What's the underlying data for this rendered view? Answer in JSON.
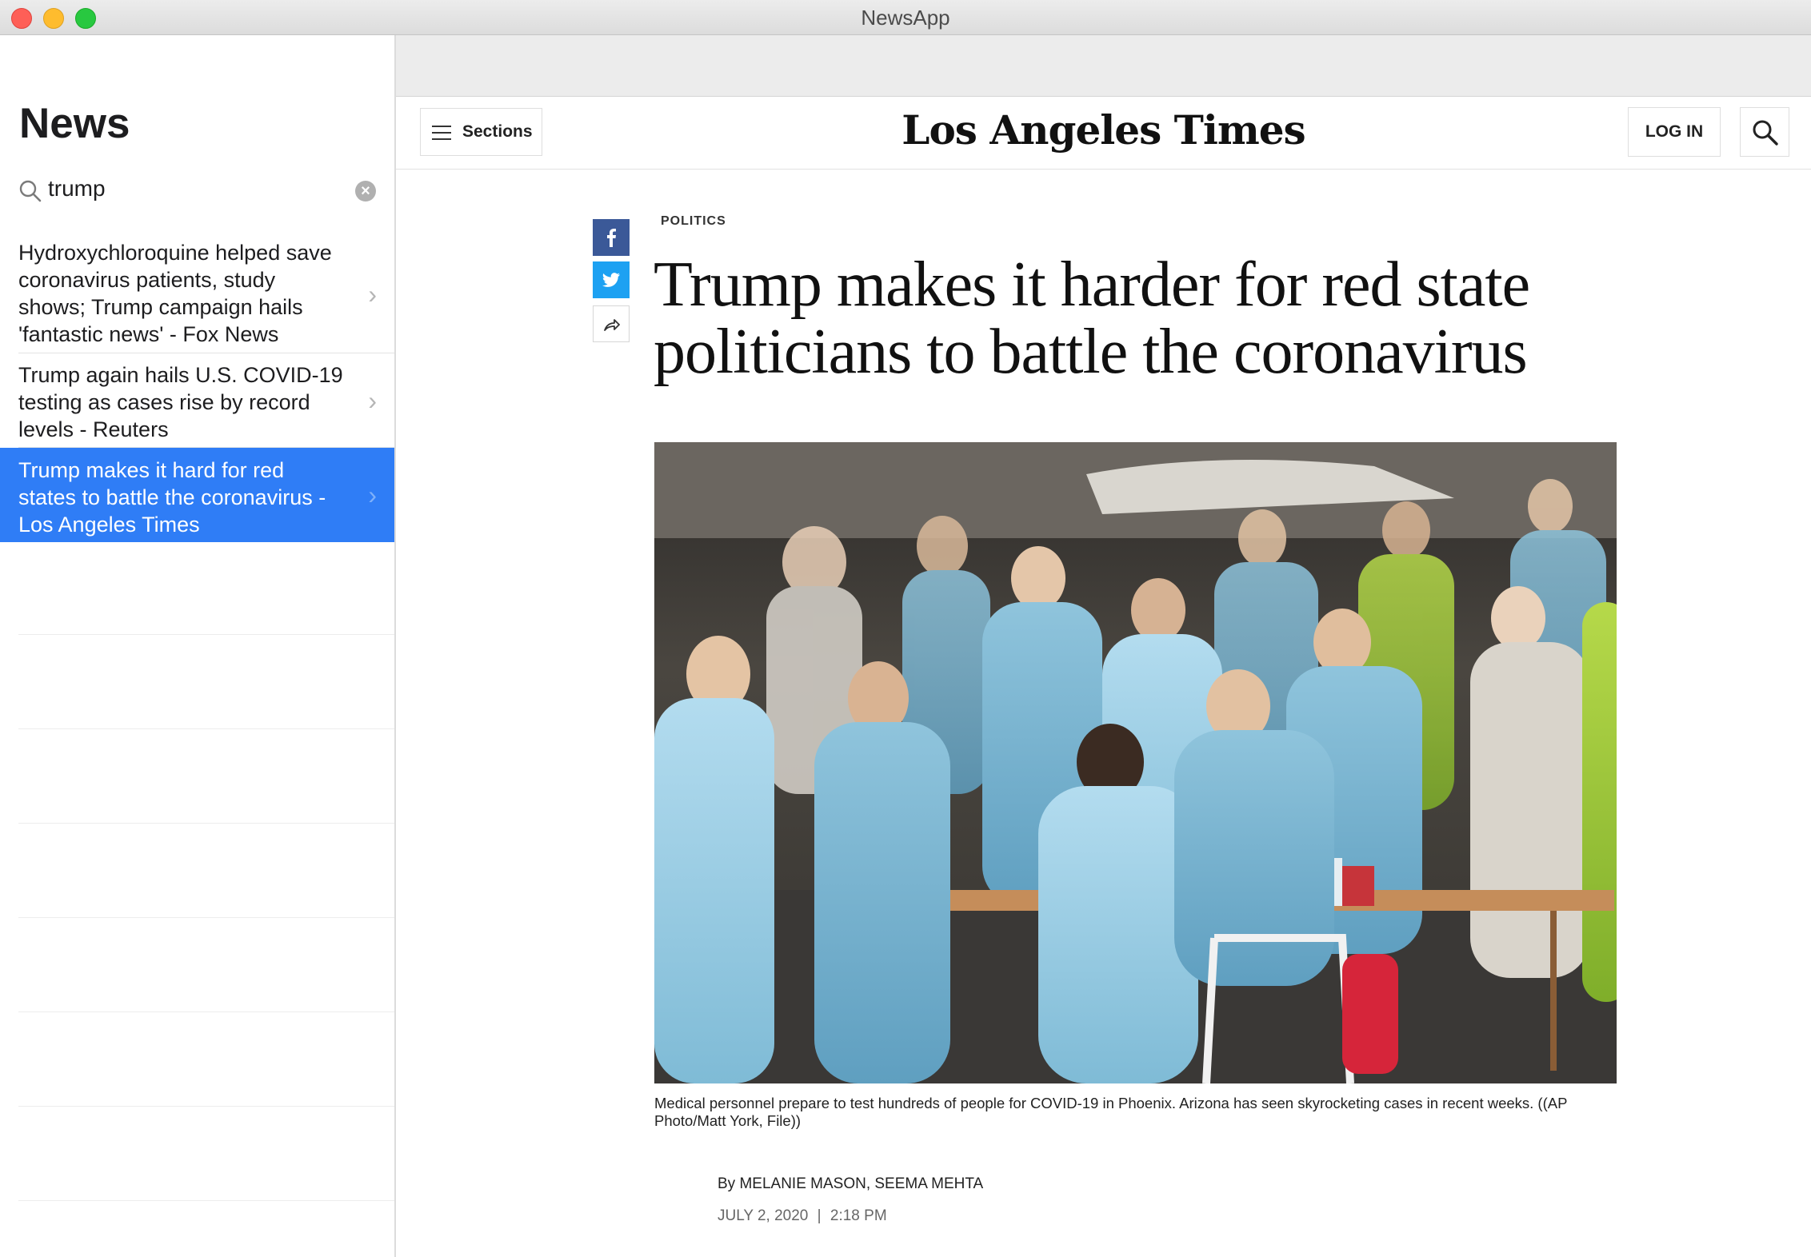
{
  "window": {
    "title": "NewsApp"
  },
  "sidebar": {
    "title": "News",
    "search": {
      "query": "trump"
    },
    "results": [
      {
        "text": "Hydroxychloroquine helped save coronavirus patients, study shows; Trump campaign hails 'fantastic news' - Fox News",
        "selected": false
      },
      {
        "text": "Trump again hails U.S. COVID-19 testing as cases rise by record levels - Reuters",
        "selected": false
      },
      {
        "text": "Trump makes it hard for red states to battle the coronavirus - Los Angeles Times",
        "selected": true
      }
    ]
  },
  "site": {
    "sections_label": "Sections",
    "logo": "Los Angeles Times",
    "login_label": "LOG IN"
  },
  "article": {
    "kicker": "POLITICS",
    "headline": "Trump makes it harder for red state politicians to battle the coronavirus",
    "caption": "Medical personnel prepare to test hundreds of people for COVID-19 in Phoenix. Arizona has seen skyrocketing cases in recent weeks. ((AP Photo/Matt York, File))",
    "byline": "By MELANIE MASON, SEEMA MEHTA",
    "date": "JULY 2, 2020",
    "time": "2:18 PM",
    "date_separator": "|"
  },
  "colors": {
    "selection": "#2f7df6",
    "facebook": "#3b5998",
    "twitter": "#1da1f2"
  },
  "icons": [
    "search-icon",
    "clear-search-icon",
    "chevron-right-icon",
    "hamburger-menu-icon",
    "magnifier-icon",
    "facebook-icon",
    "twitter-icon",
    "share-arrow-icon"
  ]
}
